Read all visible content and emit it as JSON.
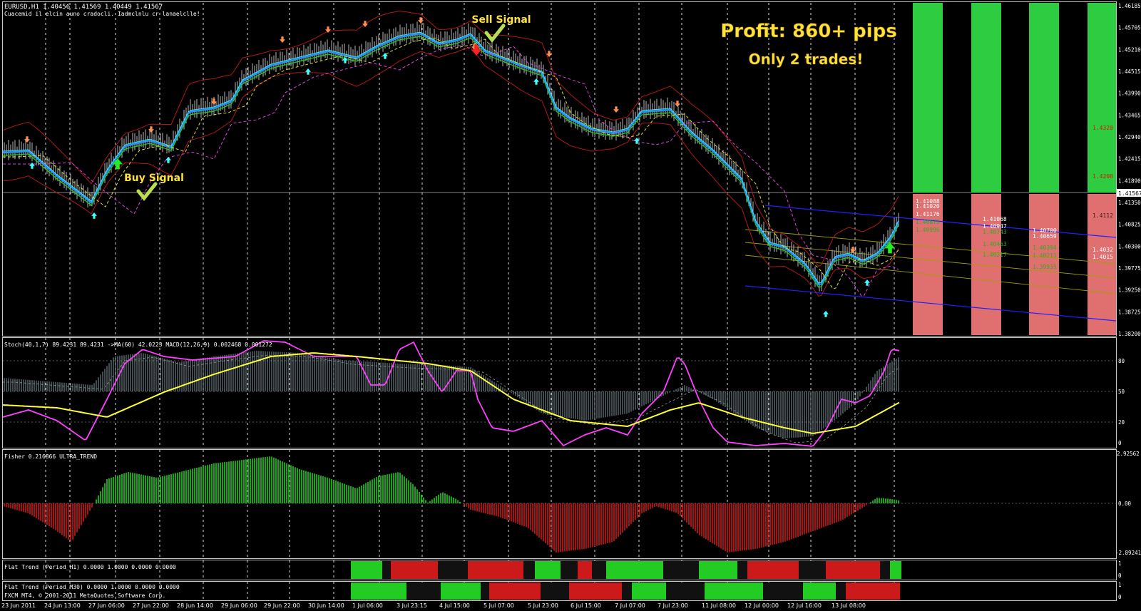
{
  "header": {
    "symbol_line": "EURUSD,H1  1.40456 1.41569 1.40449 1.41567",
    "comment_line": "Cuacemid il elcin auno cradocli. Iadmclnlu cr lanaelclle!"
  },
  "annotations": {
    "profit": "Profit: 860+ pips",
    "trades": "Only 2 trades!",
    "sell_signal": "Sell Signal",
    "buy_signal": "Buy Signal"
  },
  "colors": {
    "bg": "#000000",
    "grid": "#ffffff",
    "candle": "#b8b8b8",
    "ma_fast": "#2196f3",
    "ma_cyan": "#40e0ff",
    "ma_green": "#22cc22",
    "ma_yellow": "#e0e020",
    "ma_magenta": "#e040e0",
    "band": "#b01818",
    "bull": "#22cc22",
    "bear": "#cc1a1a",
    "zone_green": "#2ecc40",
    "zone_red": "#e07070",
    "stoch_line": "#ff40ff",
    "stoch_signal": "#ffff33",
    "accent_text": "#ffd700"
  },
  "main_panel": {
    "price_axis": [
      "1.46185",
      "1.45705",
      "1.45210",
      "1.44515",
      "1.43990",
      "1.43465",
      "1.42940",
      "1.42415",
      "1.41890",
      "1.41350",
      "1.40825",
      "1.40300",
      "1.39775",
      "1.39250",
      "1.38725",
      "1.38200"
    ],
    "current_price": "1.41567",
    "right_labels": {
      "green_top": "1.4320",
      "green_mid": "1.4208",
      "red_top": "1.4112",
      "red_low_a": "1.4032",
      "red_low_b": "1.4015"
    },
    "zone_labels": {
      "col1": [
        "1.41088",
        "1.41020",
        "1.41176",
        "1.40873",
        "1.40996"
      ],
      "col2": [
        "1.41068",
        "1.40947",
        "1.40743",
        "1.40463",
        "1.40217"
      ],
      "col3": [
        "1.40700",
        "1.40659",
        "1.40394",
        "1.40211",
        "1.39935"
      ],
      "col4": [
        "1.39930"
      ]
    }
  },
  "stoch_panel": {
    "title": "Stoch(40,1,7) 89.4231 89.4231  ->MA(60) 42.0223  MACD(12,26,9) 0.002468 0.001272",
    "levels": [
      "80",
      "50",
      "20",
      "0"
    ],
    "top_level": "100"
  },
  "fisher_panel": {
    "title": "Fisher 0.216866  ULTRA_TREND",
    "levels": [
      "2.92562",
      "0.00",
      "-2.89241"
    ]
  },
  "flat1_panel": {
    "title": "Flat Trend (Period_H1) 0.0000 1.0000 0.0000 0.0000",
    "levels": [
      "1",
      "0"
    ]
  },
  "flat2_panel": {
    "title": "Flat Trend (Period_M30) 0.0000 1.0000 0.0000 0.0000",
    "copyright": "FXCM MT4, © 2001-2011 MetaQuotes Software Corp.",
    "levels": [
      "1",
      "0"
    ]
  },
  "time_axis": [
    "23 Jun 2011",
    "24 Jun 13:00",
    "27 Jun 06:00",
    "27 Jun 22:00",
    "28 Jun 14:00",
    "29 Jun 06:00",
    "29 Jun 22:00",
    "30 Jun 14:00",
    "1 Jul 06:00",
    "3 Jul 23:15",
    "4 Jul 15:00",
    "5 Jul 07:00",
    "5 Jul 23:00",
    "6 Jul 15:00",
    "7 Jul 07:00",
    "7 Jul 23:00",
    "11 Jul 08:00",
    "12 Jul 00:00",
    "12 Jul 16:00",
    "13 Jul 08:00"
  ]
}
